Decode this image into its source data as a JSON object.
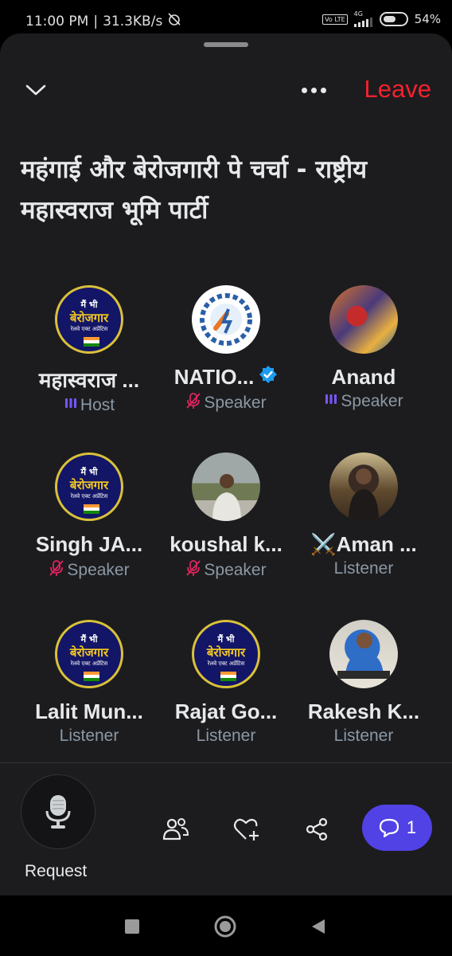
{
  "status_bar": {
    "time": "11:00 PM",
    "speed": "31.3KB/s",
    "volte": "Vo LTE",
    "network": "4G",
    "battery": "54%",
    "battery_level": 0.54
  },
  "header": {
    "leave_label": "Leave"
  },
  "space": {
    "title": "महंगाई और बेरोजगारी पे चर्चा - राष्ट्रीय महास्वराज भूमि पार्टी"
  },
  "logo_text": {
    "line1": "मैं भी",
    "line2": "बेरोजगार",
    "line3": "रेलवे एक्ट अप्रेंटिस"
  },
  "participants": [
    {
      "name": "महास्वराज ...",
      "role": "Host",
      "role_icon": "speaking-bars-icon",
      "avatar": "logo"
    },
    {
      "name": "NATIO...",
      "role": "Speaker",
      "role_icon": "mic-muted-icon",
      "avatar": "national",
      "verified": true
    },
    {
      "name": "Anand",
      "role": "Speaker",
      "role_icon": "speaking-bars-icon",
      "avatar": "photo-red"
    },
    {
      "name": "Singh JA...",
      "role": "Speaker",
      "role_icon": "mic-muted-icon",
      "avatar": "logo"
    },
    {
      "name": "koushal k...",
      "role": "Speaker",
      "role_icon": "mic-muted-icon",
      "avatar": "photo-mountain"
    },
    {
      "name": "⚔️Aman ...",
      "role": "Listener",
      "role_icon": "",
      "avatar": "photo-dark"
    },
    {
      "name": "Lalit Mun...",
      "role": "Listener",
      "role_icon": "",
      "avatar": "logo"
    },
    {
      "name": "Rajat Go...",
      "role": "Listener",
      "role_icon": "",
      "avatar": "logo"
    },
    {
      "name": "Rakesh K...",
      "role": "Listener",
      "role_icon": "",
      "avatar": "photo-blue"
    }
  ],
  "bottom_bar": {
    "request_label": "Request",
    "chat_count": "1"
  },
  "colors": {
    "sheet_bg": "#1c1c1e",
    "leave": "#f4212e",
    "host_accent": "#7856ff",
    "muted_accent": "#e0245e",
    "chat_button": "#5142e6",
    "verified": "#1d9bf0"
  }
}
